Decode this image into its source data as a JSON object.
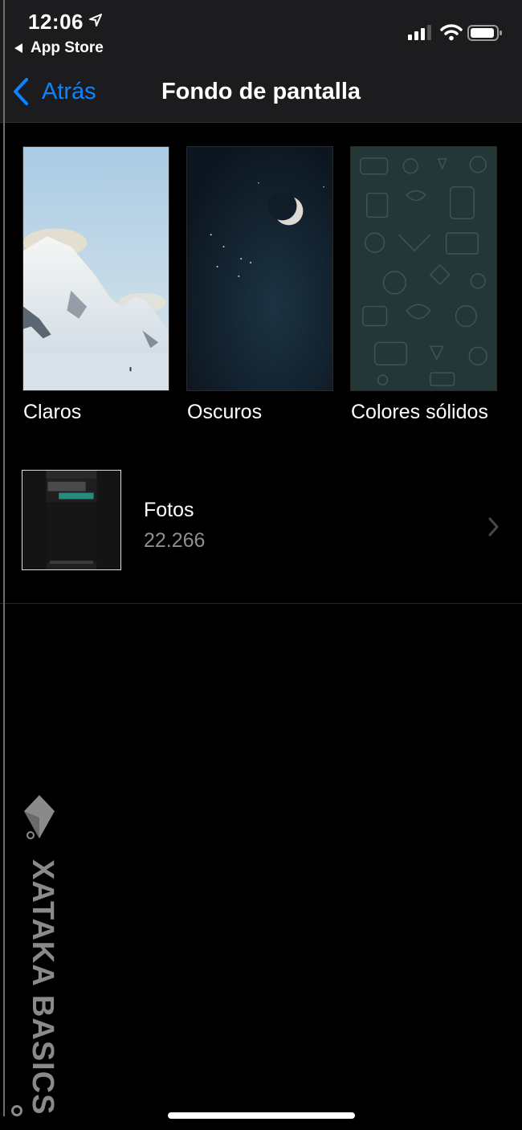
{
  "status_bar": {
    "time": "12:06",
    "back_app": "App Store"
  },
  "nav": {
    "back_label": "Atrás",
    "title": "Fondo de pantalla"
  },
  "wallpaper_categories": [
    {
      "label": "Claros"
    },
    {
      "label": "Oscuros"
    },
    {
      "label": "Colores sólidos"
    }
  ],
  "photos": {
    "label": "Fotos",
    "count": "22.266"
  },
  "watermark": "XATAKA BASICS",
  "colors": {
    "accent": "#0a84ff",
    "background": "#000000",
    "header": "#1c1c1e",
    "secondary_text": "#8e8e93"
  }
}
